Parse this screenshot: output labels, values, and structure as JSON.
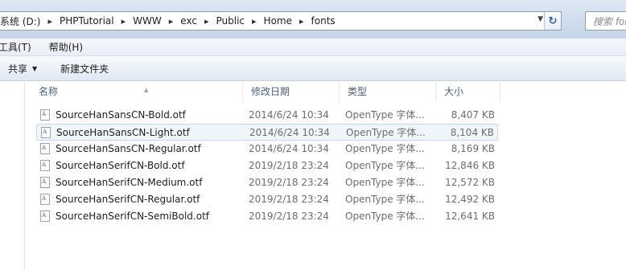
{
  "address": {
    "crumbs": [
      "系统 (D:)",
      "PHPTutorial",
      "WWW",
      "exc",
      "Public",
      "Home",
      "fonts"
    ],
    "separator": "▸"
  },
  "search": {
    "placeholder": "搜索 fonts"
  },
  "menu": {
    "tools": "工具(T)",
    "help": "帮助(H)"
  },
  "commands": {
    "share": "共享",
    "new_folder": "新建文件夹"
  },
  "columns": {
    "name": "名称",
    "date": "修改日期",
    "type": "类型",
    "size": "大小"
  },
  "files": [
    {
      "name": "SourceHanSansCN-Bold.otf",
      "date": "2014/6/24 10:34",
      "type": "OpenType 字体...",
      "size": "8,407 KB"
    },
    {
      "name": "SourceHanSansCN-Light.otf",
      "date": "2014/6/24 10:34",
      "type": "OpenType 字体...",
      "size": "8,104 KB"
    },
    {
      "name": "SourceHanSansCN-Regular.otf",
      "date": "2014/6/24 10:34",
      "type": "OpenType 字体...",
      "size": "8,169 KB"
    },
    {
      "name": "SourceHanSerifCN-Bold.otf",
      "date": "2019/2/18 23:24",
      "type": "OpenType 字体...",
      "size": "12,846 KB"
    },
    {
      "name": "SourceHanSerifCN-Medium.otf",
      "date": "2019/2/18 23:24",
      "type": "OpenType 字体...",
      "size": "12,572 KB"
    },
    {
      "name": "SourceHanSerifCN-Regular.otf",
      "date": "2019/2/18 23:24",
      "type": "OpenType 字体...",
      "size": "12,492 KB"
    },
    {
      "name": "SourceHanSerifCN-SemiBold.otf",
      "date": "2019/2/18 23:24",
      "type": "OpenType 字体...",
      "size": "12,641 KB"
    }
  ],
  "hover_row_index": 1
}
